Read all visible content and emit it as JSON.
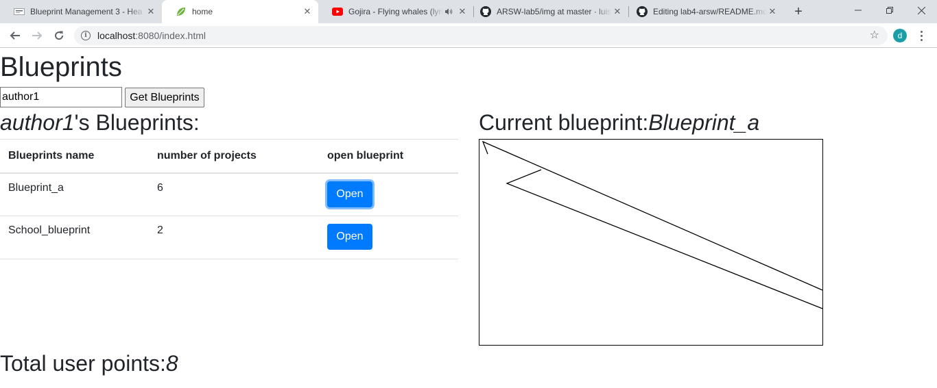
{
  "browser": {
    "tabs": [
      {
        "title": "Blueprint Management 3 - Hea",
        "icon": "blueprint-favicon",
        "active": false
      },
      {
        "title": "home",
        "icon": "spring-leaf-favicon",
        "active": true
      },
      {
        "title": "Gojira - Flying whales (lyric",
        "icon": "youtube-favicon",
        "active": false,
        "audio": true
      },
      {
        "title": "ARSW-lab5/img at master · luis",
        "icon": "github-favicon",
        "active": false
      },
      {
        "title": "Editing lab4-arsw/README.md",
        "icon": "github-favicon",
        "active": false
      }
    ],
    "url_host": "localhost",
    "url_path": ":8080/index.html",
    "profile_initial": "d"
  },
  "page": {
    "title": "Blueprints",
    "author_input_value": "author1",
    "get_button_label": "Get Blueprints",
    "author_name": "author1",
    "author_suffix": "'s Blueprints:",
    "table": {
      "headers": [
        "Blueprints name",
        "number of projects",
        "open blueprint"
      ],
      "rows": [
        {
          "name": "Blueprint_a",
          "points": "6",
          "button": "Open"
        },
        {
          "name": "School_blueprint",
          "points": "2",
          "button": "Open"
        }
      ]
    },
    "current_label": "Current blueprint:",
    "current_name": "Blueprint_a",
    "total_label": "Total user points:",
    "total_value": "8",
    "colors": {
      "primary": "#007bff",
      "text": "#212529"
    }
  }
}
